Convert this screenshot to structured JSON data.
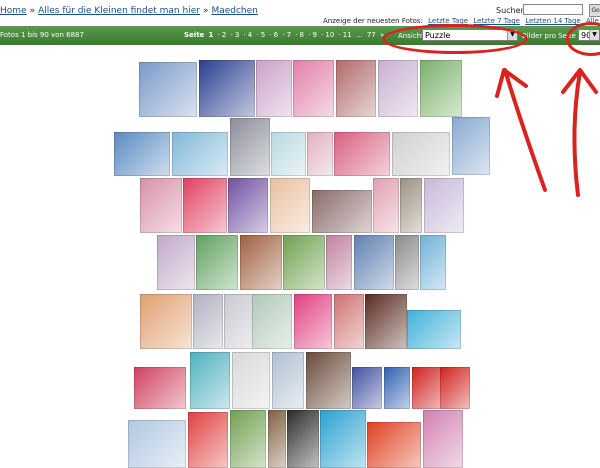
{
  "breadcrumb": {
    "home": "Home",
    "category": "Alles für die Kleinen findet man hier",
    "sub": "Maedchen",
    "sep": "»"
  },
  "search": {
    "label": "Suchen",
    "placeholder": "",
    "button": "Go"
  },
  "newest": {
    "label": "Anzeige der neuesten Fotos:",
    "links": [
      "Letzte Tage",
      "Letzte 7 Tage",
      "Letzten 14 Tage",
      "Alle Fotos"
    ]
  },
  "bar": {
    "info": "Fotos 1 bis 90 von 6887",
    "page_label": "Seite",
    "current_page": "1",
    "pages": [
      "2",
      "3",
      "4",
      "5",
      "6",
      "7",
      "8",
      "9",
      "10",
      "11",
      "...",
      "77",
      "»"
    ],
    "view_label": "Ansicht",
    "view_value": "Puzzle",
    "perpage_label": "Bilder pro Seite",
    "perpage_value": "90"
  },
  "thumbnail_icon": "photo-thumbnail",
  "annotation_color": "#d8231f"
}
